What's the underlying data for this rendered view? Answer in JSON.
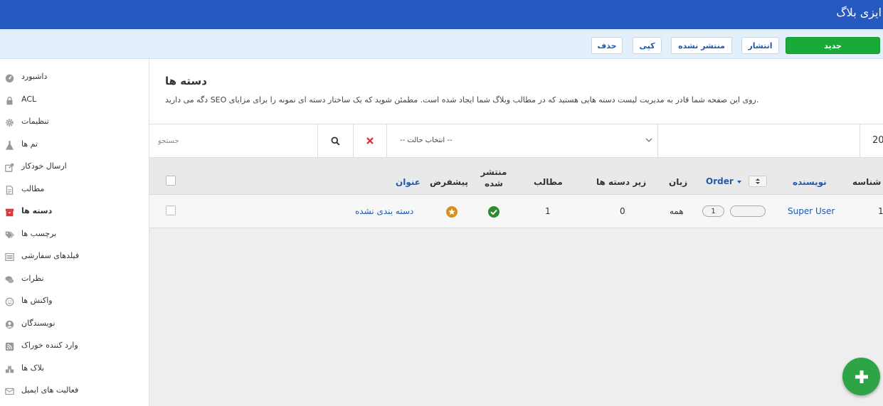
{
  "app": {
    "title": "ایزی بلاگ"
  },
  "toolbar": {
    "new_label": "جدید",
    "publish_label": "انتشار",
    "unpublish_label": "منتشر نشده",
    "copy_label": "کپی",
    "delete_label": "حذف"
  },
  "sidebar": {
    "items": [
      {
        "label": "داشبورد",
        "icon": "dashboard-icon"
      },
      {
        "label": "ACL",
        "icon": "lock-icon"
      },
      {
        "label": "تنظیمات",
        "icon": "gear-icon"
      },
      {
        "label": "تم ها",
        "icon": "flask-icon"
      },
      {
        "label": "ارسال خودکار",
        "icon": "share-icon"
      },
      {
        "label": "مطالب",
        "icon": "document-icon"
      },
      {
        "label": "دسته ها",
        "icon": "archive-box-icon",
        "active": true
      },
      {
        "label": "برچسب ها",
        "icon": "tags-icon"
      },
      {
        "label": "فیلدهای سفارشی",
        "icon": "list-icon"
      },
      {
        "label": "نظرات",
        "icon": "comments-icon"
      },
      {
        "label": "واکنش ها",
        "icon": "smiley-icon"
      },
      {
        "label": "نویسندگان",
        "icon": "user-icon"
      },
      {
        "label": "وارد کننده خوراک",
        "icon": "rss-icon"
      },
      {
        "label": "بلاک ها",
        "icon": "cubes-icon"
      },
      {
        "label": "فعالیت های ایمیل",
        "icon": "envelope-icon"
      }
    ]
  },
  "page": {
    "title": "دسته ها",
    "description": "دگه می دارید SEO روی این صفحه شما قادر به مدیریت لیست دسته هایی هستید که در مطالب وبلاگ شما ایجاد شده است. مطمئن شوید که یک ساختار دسته ای نمونه را برای مزایای."
  },
  "filters": {
    "search_placeholder": "جستجو",
    "state_select": "-- انتخاب حالت --",
    "limit": "20"
  },
  "table": {
    "columns": {
      "title": "عنوان",
      "default": "پیشفرض",
      "published": [
        "منتشر",
        "شده"
      ],
      "posts": "مطالب",
      "subcategories": "زیر دسته ها",
      "language": "زبان",
      "order": "Order",
      "author": "نویسنده",
      "id": "شناسه"
    },
    "rows": [
      {
        "title": "دسته بندی نشده",
        "posts": "1",
        "subcategories": "0",
        "language": "همه",
        "order": "1",
        "author": "Super User",
        "id": "1"
      }
    ]
  },
  "colors": {
    "topbar": "#2559c0",
    "toolbar_bg": "#e3f0fc",
    "new_button": "#1aaa3a",
    "link": "#1f5ab0",
    "published": "#2e8b2e",
    "default_star": "#d8901a",
    "fab": "#2fa446"
  }
}
